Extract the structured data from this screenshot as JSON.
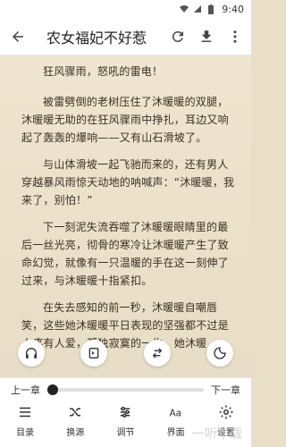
{
  "status": {
    "time": "9:40"
  },
  "app_bar": {
    "title": "农女福妃不好惹"
  },
  "reader": {
    "paragraphs": [
      "狂风骤雨，怒吼的雷电！",
      "被雷劈倒的老树压住了沐暖暖的双腿，沐暖暖无助的在狂风骤雨中挣扎，耳边又响起了轰轰的爆响——又有山石滑坡了。",
      "与山体滑坡一起飞驰而来的，还有男人穿越暴风雨惊天动地的呐喊声：“沐暖暖，我来了，别怕！”",
      "下一刻泥失流吞噬了沐暖暖眼睛里的最后一丝光亮，彻骨的寒冷让沐暖暖产生了致命幻觉，就像有一只温暖的手在这一刻伸了过来，与沐暖暖十指紧扣。",
      "在失去感知的前一秒，沐暖暖自嘲唇笑，这些她沐暖暖平日表现的坚强都不过是人疼有人爱，孤独寂寞的一生，她沐暖"
    ]
  },
  "controls": {
    "prev_chapter": "上一章",
    "next_chapter": "下一章",
    "progress": 0.0,
    "menu": [
      {
        "label": "目录",
        "icon": "list-icon"
      },
      {
        "label": "换源",
        "icon": "shuffle-icon"
      },
      {
        "label": "调节",
        "icon": "adjust-icon"
      },
      {
        "label": "界面",
        "icon": "font-icon"
      },
      {
        "label": "设置",
        "icon": "settings-icon"
      }
    ]
  },
  "quick_actions": [
    {
      "icon": "headphones-icon"
    },
    {
      "icon": "auto-page-icon"
    },
    {
      "icon": "replace-icon"
    },
    {
      "icon": "night-mode-icon"
    }
  ],
  "watermark": "一听下载"
}
